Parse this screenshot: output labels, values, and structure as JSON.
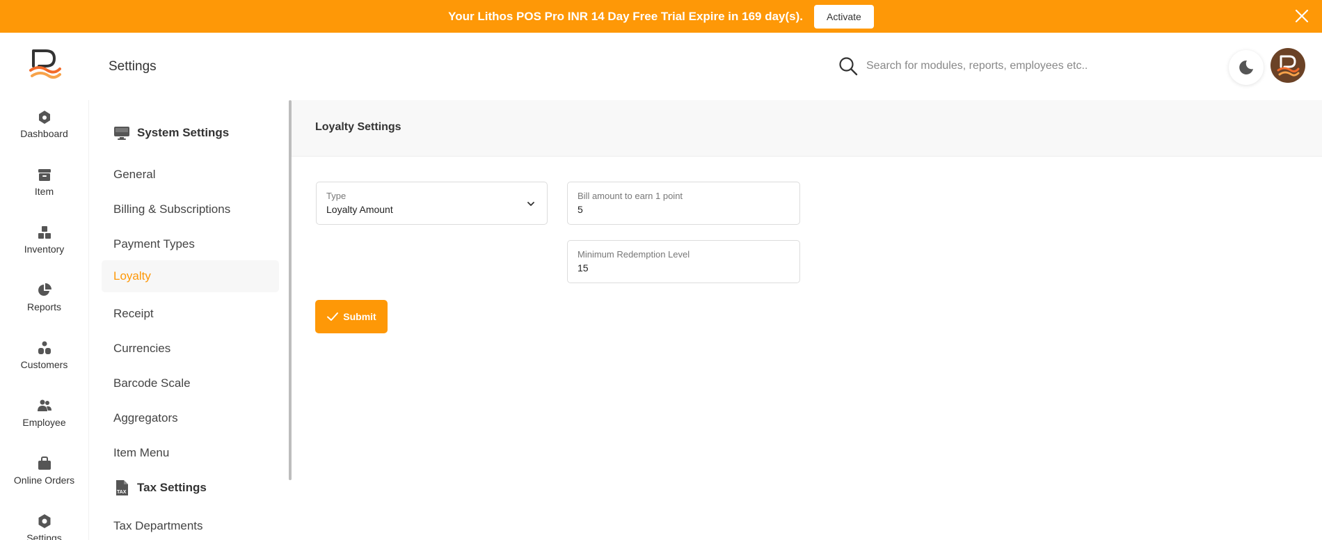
{
  "banner": {
    "text": "Your Lithos POS Pro INR 14 Day Free Trial Expire in 169 day(s).",
    "activate_label": "Activate"
  },
  "rail": {
    "items": [
      {
        "label": "Dashboard",
        "icon": "home-icon"
      },
      {
        "label": "Item",
        "icon": "archive-icon"
      },
      {
        "label": "Inventory",
        "icon": "boxes-icon"
      },
      {
        "label": "Reports",
        "icon": "pie-chart-icon"
      },
      {
        "label": "Customers",
        "icon": "customers-icon"
      },
      {
        "label": "Employee",
        "icon": "users-icon"
      },
      {
        "label": "Online Orders",
        "icon": "bag-icon"
      },
      {
        "label": "Settings",
        "icon": "gear-icon"
      }
    ]
  },
  "header": {
    "title": "Settings",
    "search_placeholder": "Search for modules, reports, employees etc.."
  },
  "subnav": {
    "system_title": "System Settings",
    "items": [
      "General",
      "Billing & Subscriptions",
      "Payment Types",
      "Loyalty",
      "Receipt",
      "Currencies",
      "Barcode Scale",
      "Aggregators",
      "Item Menu"
    ],
    "active": "Loyalty",
    "tax_title": "Tax Settings",
    "tax_items": [
      "Tax Departments"
    ]
  },
  "main": {
    "title": "Loyalty Settings",
    "type_label": "Type",
    "type_value": "Loyalty Amount",
    "bill_label": "Bill amount to earn 1 point",
    "bill_value": "5",
    "min_label": "Minimum Redemption Level",
    "min_value": "15",
    "submit_label": "Submit"
  },
  "colors": {
    "accent": "#fe9807",
    "text": "#333333"
  }
}
